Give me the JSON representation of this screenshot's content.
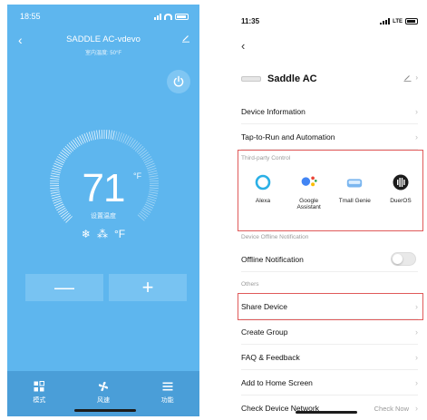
{
  "left": {
    "status_time": "18:55",
    "title": "SADDLE AC-vdevo",
    "subtitle": "室内温度: 50°F",
    "temperature": "71",
    "temp_unit": "°F",
    "set_label": "设置温度",
    "mode_snow": "❄",
    "mode_fan": "⁂",
    "mode_unit": "°F",
    "minus_label": "—",
    "plus_label": "+",
    "tabs": [
      {
        "label": "模式",
        "icon": "mode-grid-icon"
      },
      {
        "label": "风速",
        "icon": "fan-icon"
      },
      {
        "label": "功能",
        "icon": "menu-icon"
      }
    ],
    "colors": {
      "background": "#5eb6ee",
      "tabbar": "#4a9ed8"
    }
  },
  "right": {
    "status_time": "11:35",
    "network": "LTE",
    "device_name": "Saddle AC",
    "rows": {
      "device_info": "Device Information",
      "tap_to_run": "Tap-to-Run and Automation",
      "offline_notification": "Offline Notification",
      "share_device": "Share Device",
      "create_group": "Create Group",
      "faq": "FAQ & Feedback",
      "add_home": "Add to Home Screen",
      "check_network": "Check Device Network",
      "check_network_value": "Check Now"
    },
    "sections": {
      "third_party": "Third-party Control",
      "offline": "Device Offline Notification",
      "others": "Others"
    },
    "third_party": [
      {
        "label": "Alexa",
        "icon": "alexa-icon"
      },
      {
        "label": "Google Assistant",
        "icon": "google-assistant-icon"
      },
      {
        "label": "Tmall Genie",
        "icon": "tmall-genie-icon"
      },
      {
        "label": "DuerOS",
        "icon": "dueros-icon"
      }
    ],
    "colors": {
      "highlight": "#e05a5a"
    }
  }
}
